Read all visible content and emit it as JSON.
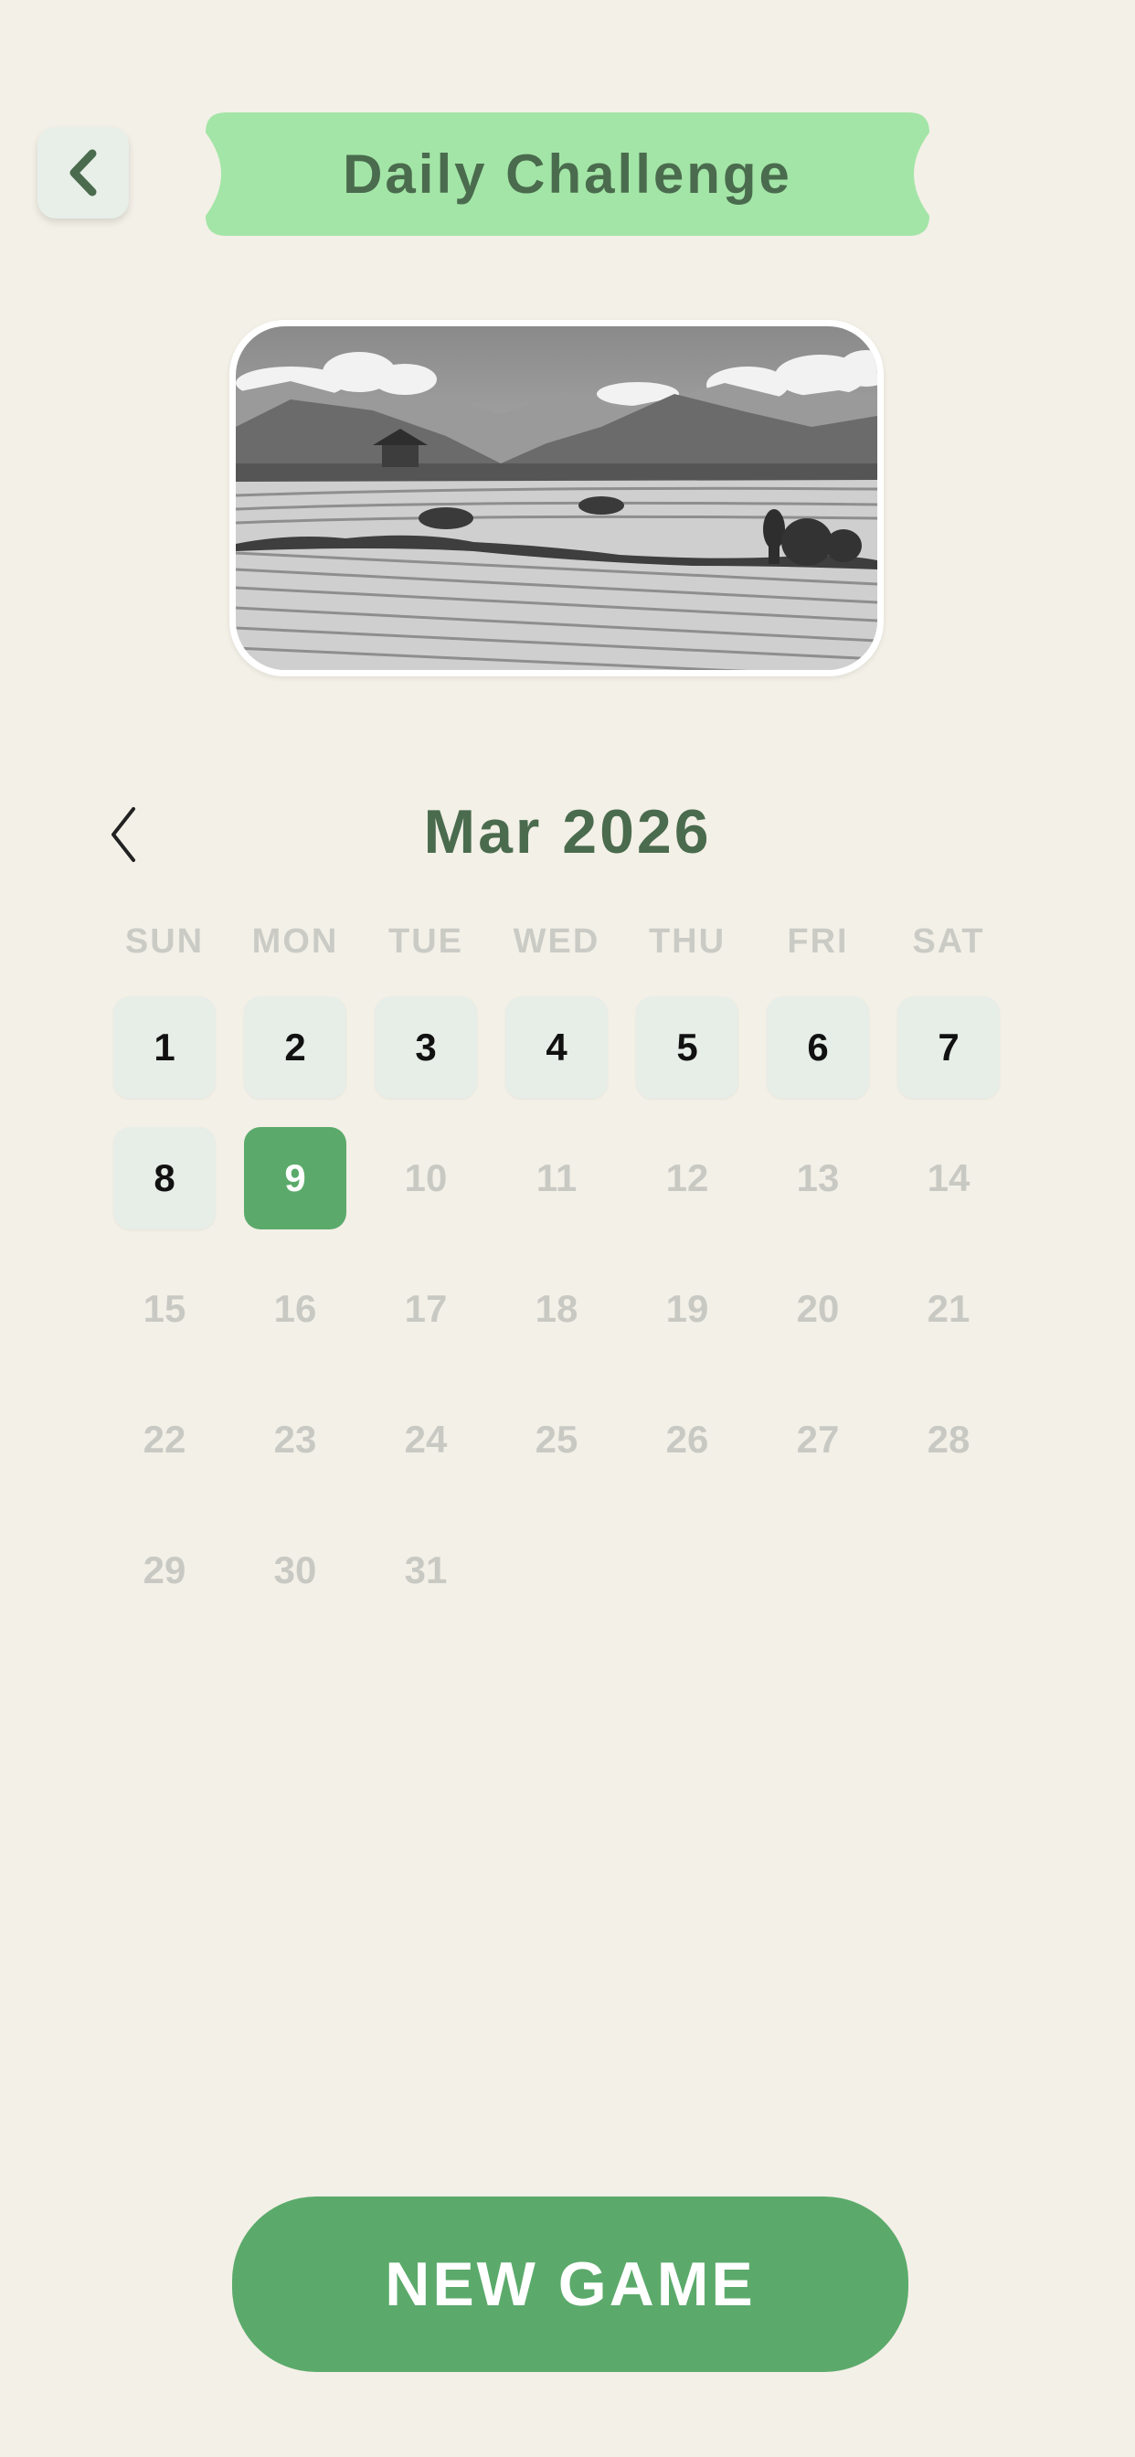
{
  "header": {
    "back_icon": "chevron-left-icon",
    "title": "Daily Challenge"
  },
  "hero_image": {
    "description": "grayscale rice terrace landscape"
  },
  "calendar": {
    "month_label": "Mar 2026",
    "prev_icon": "chevron-left-icon",
    "weekdays": [
      "SUN",
      "MON",
      "TUE",
      "WED",
      "THU",
      "FRI",
      "SAT"
    ],
    "days": [
      {
        "n": "1",
        "state": "played"
      },
      {
        "n": "2",
        "state": "played"
      },
      {
        "n": "3",
        "state": "played"
      },
      {
        "n": "4",
        "state": "played"
      },
      {
        "n": "5",
        "state": "played"
      },
      {
        "n": "6",
        "state": "played"
      },
      {
        "n": "7",
        "state": "played"
      },
      {
        "n": "8",
        "state": "played"
      },
      {
        "n": "9",
        "state": "today"
      },
      {
        "n": "10",
        "state": "future"
      },
      {
        "n": "11",
        "state": "future"
      },
      {
        "n": "12",
        "state": "future"
      },
      {
        "n": "13",
        "state": "future"
      },
      {
        "n": "14",
        "state": "future"
      },
      {
        "n": "15",
        "state": "future"
      },
      {
        "n": "16",
        "state": "future"
      },
      {
        "n": "17",
        "state": "future"
      },
      {
        "n": "18",
        "state": "future"
      },
      {
        "n": "19",
        "state": "future"
      },
      {
        "n": "20",
        "state": "future"
      },
      {
        "n": "21",
        "state": "future"
      },
      {
        "n": "22",
        "state": "future"
      },
      {
        "n": "23",
        "state": "future"
      },
      {
        "n": "24",
        "state": "future"
      },
      {
        "n": "25",
        "state": "future"
      },
      {
        "n": "26",
        "state": "future"
      },
      {
        "n": "27",
        "state": "future"
      },
      {
        "n": "28",
        "state": "future"
      },
      {
        "n": "29",
        "state": "future"
      },
      {
        "n": "30",
        "state": "future"
      },
      {
        "n": "31",
        "state": "future"
      }
    ]
  },
  "actions": {
    "new_game_label": "NEW GAME"
  },
  "colors": {
    "background": "#f3f0e7",
    "accent": "#5baa6b",
    "banner": "#a3e5a7",
    "title_text": "#4a6b4d",
    "played_tile": "#e7ede7",
    "future_text": "#c9c9c4"
  }
}
